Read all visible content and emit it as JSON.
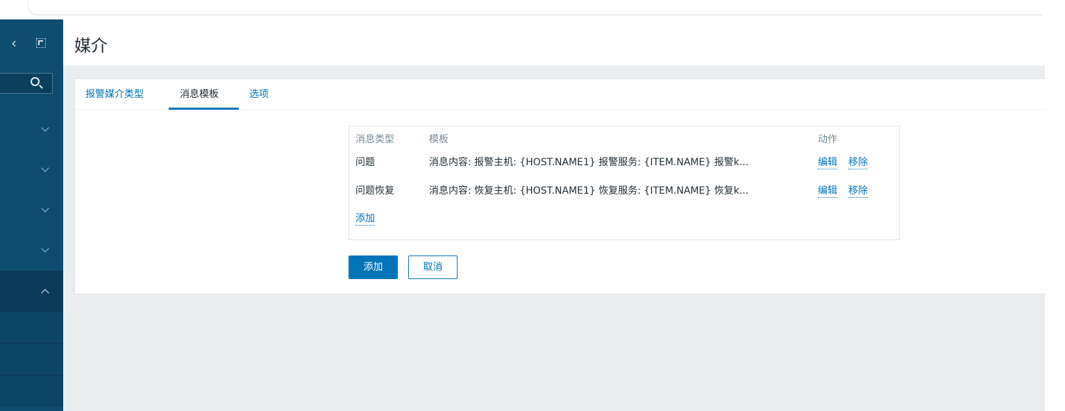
{
  "page": {
    "title": "媒介"
  },
  "tabs": [
    {
      "label": "报警媒介类型",
      "active": false
    },
    {
      "label": "消息模板",
      "active": true
    },
    {
      "label": "选项",
      "active": false
    }
  ],
  "table": {
    "headers": {
      "type": "消息类型",
      "template": "模板",
      "actions": "动作"
    },
    "rows": [
      {
        "type": "问题",
        "template": "消息内容: 报警主机: {HOST.NAME1} 报警服务: {ITEM.NAME} 报警k...",
        "edit": "编辑",
        "remove": "移除"
      },
      {
        "type": "问题恢复",
        "template": "消息内容: 恢复主机: {HOST.NAME1} 恢复服务: {ITEM.NAME} 恢复k...",
        "edit": "编辑",
        "remove": "移除"
      }
    ],
    "add_link": "添加"
  },
  "buttons": {
    "add": "添加",
    "cancel": "取消"
  },
  "sidebar": {
    "collapse_icon": "chevron-left-icon",
    "toggle_icon": "expand-icon",
    "search_icon": "search-icon"
  },
  "colors": {
    "sidebar": "#0f4d70",
    "accent": "#0275b8",
    "background": "#ebeef0"
  }
}
